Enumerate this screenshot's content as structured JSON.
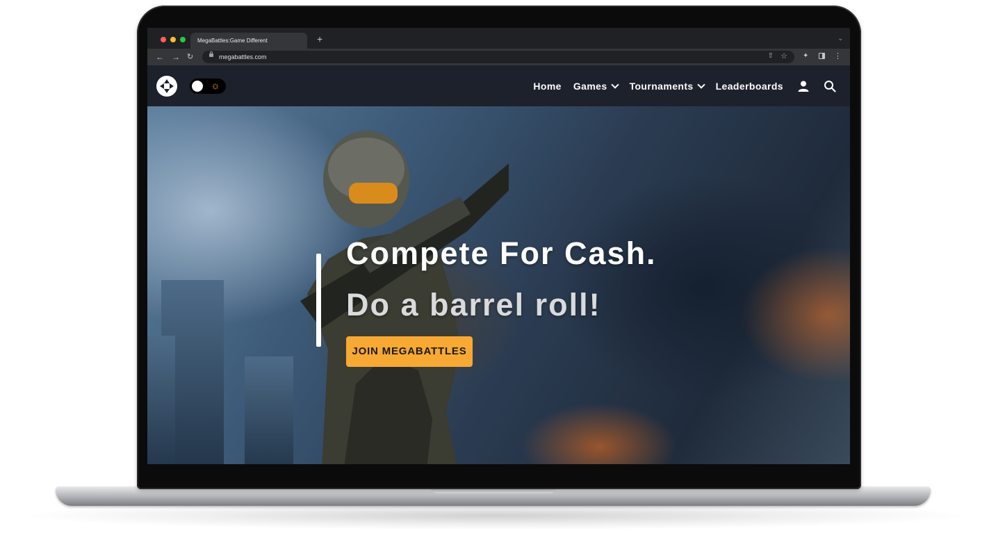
{
  "browser": {
    "tab_title": "MegaBattles:Game Different",
    "new_tab_symbol": "+",
    "url": "megabattles.com"
  },
  "site": {
    "nav": [
      {
        "label": "Home",
        "has_dropdown": false
      },
      {
        "label": "Games",
        "has_dropdown": true
      },
      {
        "label": "Tournaments",
        "has_dropdown": true
      },
      {
        "label": "Leaderboards",
        "has_dropdown": false
      }
    ],
    "icons": {
      "logo": "gamepad-icon",
      "theme": "sun-icon",
      "account": "user-icon",
      "search": "search-icon"
    }
  },
  "hero": {
    "title": "Compete For Cash.",
    "subtitle": "Do a barrel roll!",
    "cta_label": "JOIN MEGABATTLES"
  },
  "colors": {
    "header_bg": "#1d212c",
    "cta_bg": "#f7a933",
    "accent_sun": "#f6a21a"
  }
}
